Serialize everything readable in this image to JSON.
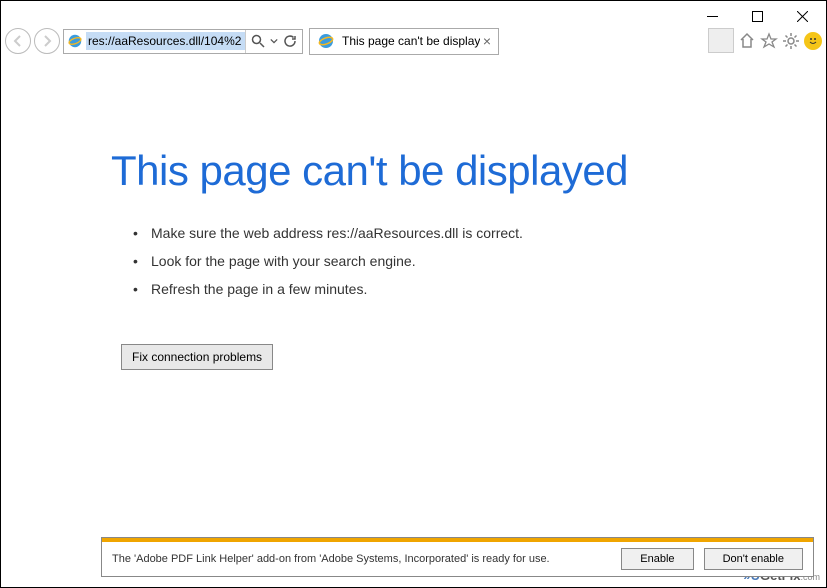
{
  "address_bar": {
    "url": "res://aaResources.dll/104%2"
  },
  "tab": {
    "title": "This page can't be displayed"
  },
  "page": {
    "title": "This page can't be displayed",
    "suggestions": [
      "Make sure the web address res://aaResources.dll is correct.",
      "Look for the page with your search engine.",
      "Refresh the page in a few minutes."
    ],
    "fix_button": "Fix connection problems"
  },
  "addon_bar": {
    "message": "The 'Adobe PDF Link Helper' add-on from 'Adobe Systems, Incorporated' is ready for use.",
    "enable": "Enable",
    "dont_enable": "Don't enable"
  },
  "watermark": {
    "prefix": "»U",
    "mid": "GetFix",
    "suffix": ".com"
  }
}
